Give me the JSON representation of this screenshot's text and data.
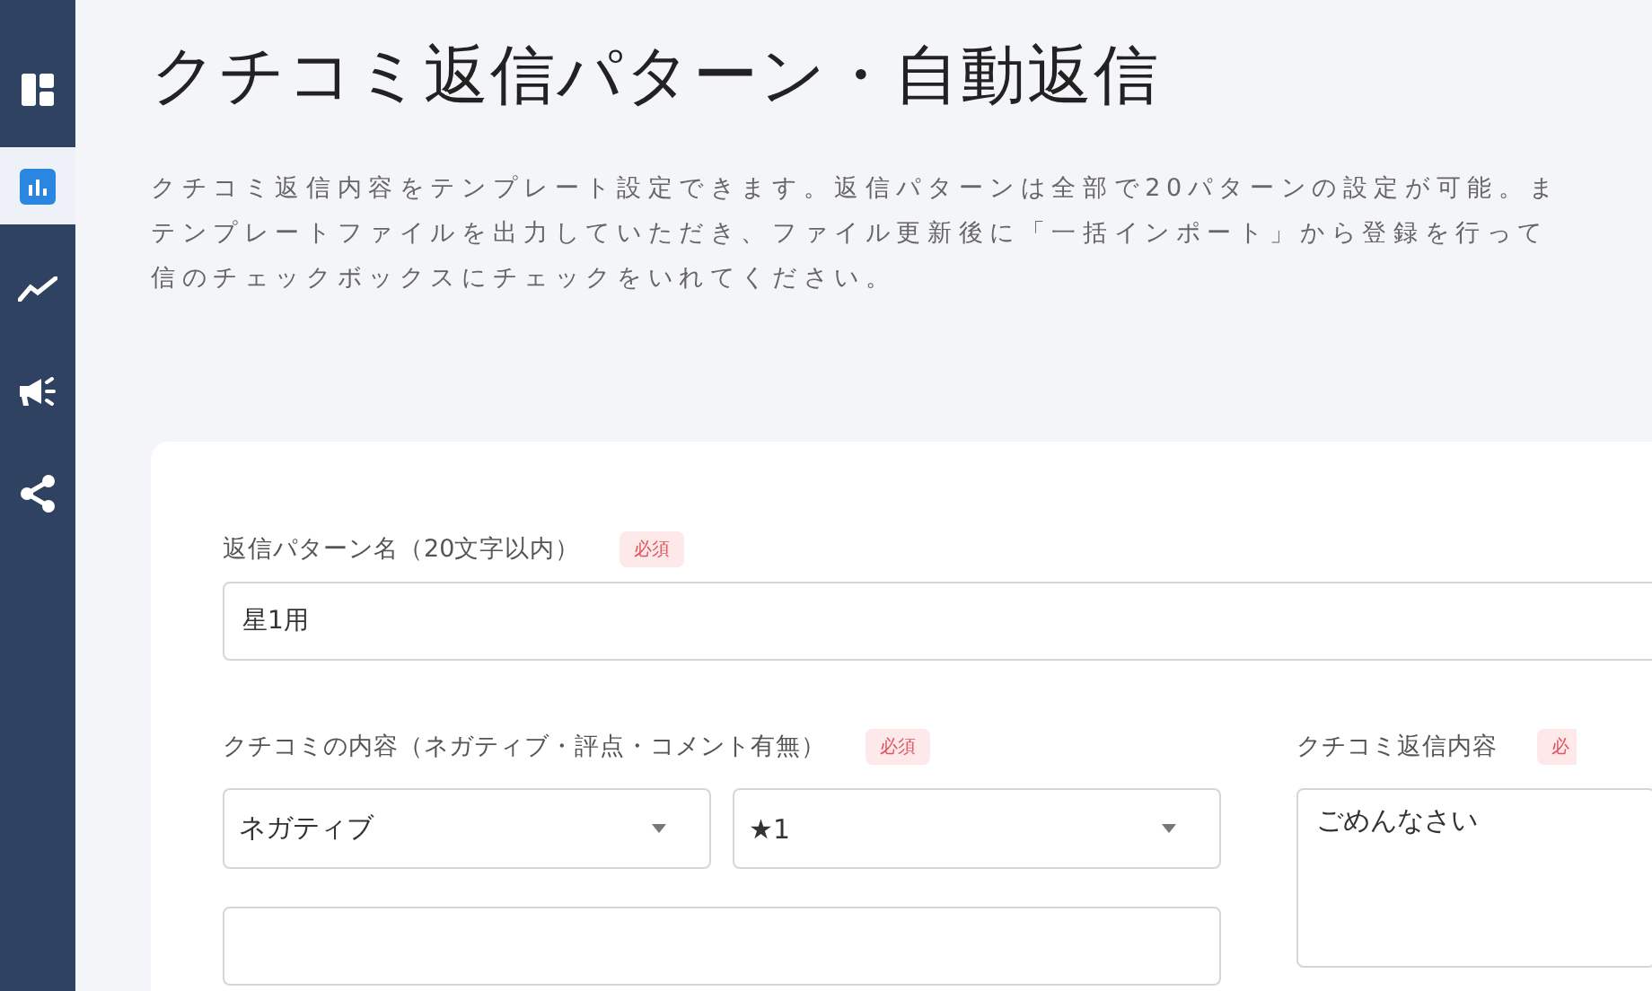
{
  "sidebar": {
    "items": [
      {
        "selected": false
      },
      {
        "selected": true
      },
      {
        "selected": false
      },
      {
        "selected": false
      },
      {
        "selected": false
      }
    ]
  },
  "page": {
    "title": "クチコミ返信パターン・自動返信",
    "description_lines": [
      "クチコミ返信内容をテンプレート設定できます。返信パターンは全部で20パターンの設定が可能。ま",
      "テンプレートファイルを出力していただき、ファイル更新後に「一括インポート」から登録を行って",
      "信のチェックボックスにチェックをいれてください。"
    ]
  },
  "form": {
    "pattern_name": {
      "label": "返信パターン名（20文字以内）",
      "badge": "必須",
      "value": "星1用"
    },
    "review_content": {
      "label": "クチコミの内容（ネガティブ・評点・コメント有無）",
      "badge": "必須",
      "selects": [
        {
          "value": "ネガティブ"
        },
        {
          "value": "★1"
        }
      ]
    },
    "reply_content": {
      "label": "クチコミ返信内容",
      "badge": "必",
      "value": "ごめんなさい"
    }
  }
}
